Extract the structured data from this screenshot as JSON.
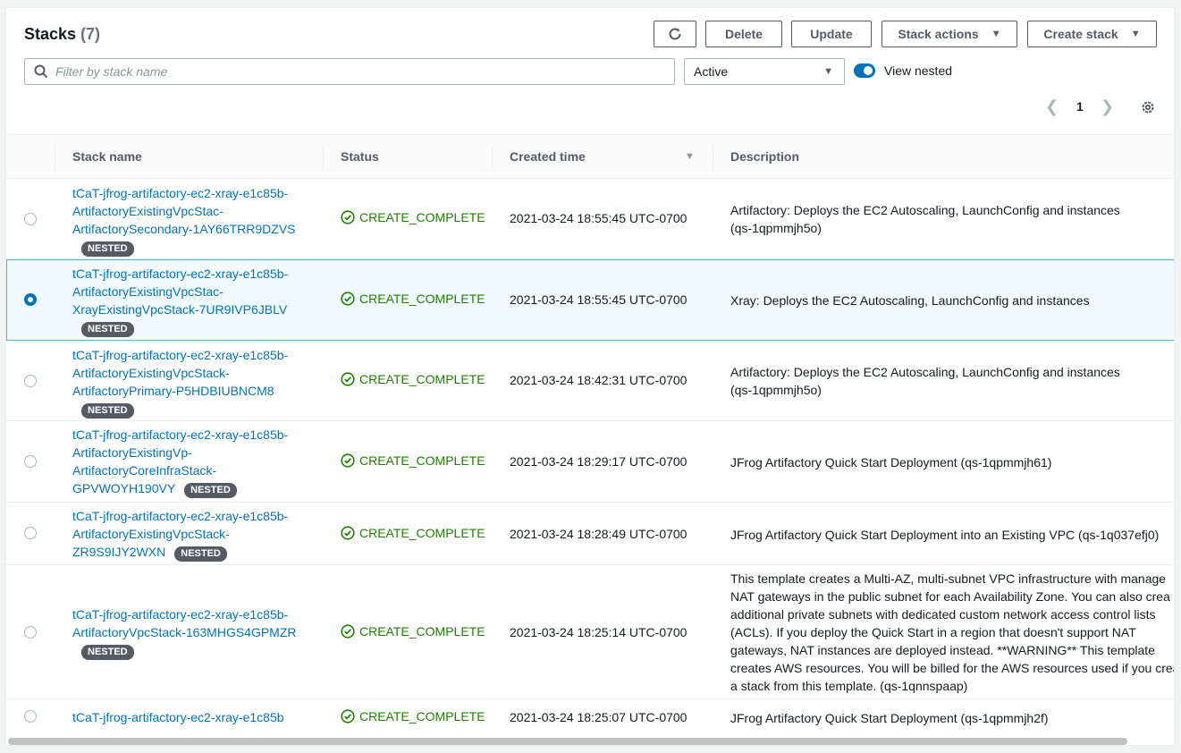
{
  "header": {
    "title": "Stacks",
    "count": "(7)",
    "refresh_icon": "refresh-icon",
    "buttons": {
      "delete": "Delete",
      "update": "Update",
      "stack_actions": "Stack actions",
      "create_stack": "Create stack"
    }
  },
  "filter": {
    "search_placeholder": "Filter by stack name",
    "status_select": "Active",
    "view_nested_label": "View nested",
    "view_nested_on": true
  },
  "pagination": {
    "current_page": "1"
  },
  "table": {
    "columns": {
      "name": "Stack name",
      "status": "Status",
      "created": "Created time",
      "description": "Description"
    },
    "badge_label": "NESTED",
    "rows": [
      {
        "name_lines": [
          "tCaT-jfrog-artifactory-ec2-xray-e1c85b-",
          "ArtifactoryExistingVpcStac-",
          "ArtifactorySecondary-1AY66TRR9DZVS"
        ],
        "nested": true,
        "status": "CREATE_COMPLETE",
        "created": "2021-03-24 18:55:45 UTC-0700",
        "description_lines": [
          "Artifactory: Deploys the EC2 Autoscaling, LaunchConfig and instances",
          "(qs-1qpmmjh5o)"
        ],
        "selected": false
      },
      {
        "name_lines": [
          "tCaT-jfrog-artifactory-ec2-xray-e1c85b-",
          "ArtifactoryExistingVpcStac-",
          "XrayExistingVpcStack-7UR9IVP6JBLV"
        ],
        "nested": true,
        "status": "CREATE_COMPLETE",
        "created": "2021-03-24 18:55:45 UTC-0700",
        "description_lines": [
          "Xray: Deploys the EC2 Autoscaling, LaunchConfig and instances"
        ],
        "selected": true
      },
      {
        "name_lines": [
          "tCaT-jfrog-artifactory-ec2-xray-e1c85b-",
          "ArtifactoryExistingVpcStack-",
          "ArtifactoryPrimary-P5HDBIUBNCM8"
        ],
        "nested": true,
        "status": "CREATE_COMPLETE",
        "created": "2021-03-24 18:42:31 UTC-0700",
        "description_lines": [
          "Artifactory: Deploys the EC2 Autoscaling, LaunchConfig and instances",
          "(qs-1qpmmjh5o)"
        ],
        "selected": false
      },
      {
        "name_lines": [
          "tCaT-jfrog-artifactory-ec2-xray-e1c85b-",
          "ArtifactoryExistingVp-",
          "ArtifactoryCoreInfraStack-",
          "GPVWOYH190VY"
        ],
        "nested": true,
        "status": "CREATE_COMPLETE",
        "created": "2021-03-24 18:29:17 UTC-0700",
        "description_lines": [
          "JFrog Artifactory Quick Start Deployment (qs-1qpmmjh61)"
        ],
        "selected": false
      },
      {
        "name_lines": [
          "tCaT-jfrog-artifactory-ec2-xray-e1c85b-",
          "ArtifactoryExistingVpcStack-",
          "ZR9S9IJY2WXN"
        ],
        "nested": true,
        "status": "CREATE_COMPLETE",
        "created": "2021-03-24 18:28:49 UTC-0700",
        "description_lines": [
          "JFrog Artifactory Quick Start Deployment into an Existing VPC (qs-1q037efj0)"
        ],
        "selected": false
      },
      {
        "name_lines": [
          "tCaT-jfrog-artifactory-ec2-xray-e1c85b-",
          "ArtifactoryVpcStack-163MHGS4GPMZR"
        ],
        "nested": true,
        "status": "CREATE_COMPLETE",
        "created": "2021-03-24 18:25:14 UTC-0700",
        "description_lines": [
          "This template creates a Multi-AZ, multi-subnet VPC infrastructure with manage",
          "NAT gateways in the public subnet for each Availability Zone. You can also crea",
          "additional private subnets with dedicated custom network access control lists",
          "(ACLs). If you deploy the Quick Start in a region that doesn't support NAT",
          "gateways, NAT instances are deployed instead. **WARNING** This template",
          "creates AWS resources. You will be billed for the AWS resources used if you crea",
          "a stack from this template. (qs-1qnnspaap)"
        ],
        "selected": false
      },
      {
        "name_lines": [
          "tCaT-jfrog-artifactory-ec2-xray-e1c85b"
        ],
        "nested": false,
        "status": "CREATE_COMPLETE",
        "created": "2021-03-24 18:25:07 UTC-0700",
        "description_lines": [
          "JFrog Artifactory Quick Start Deployment (qs-1qpmmjh2f)"
        ],
        "selected": false
      }
    ]
  }
}
